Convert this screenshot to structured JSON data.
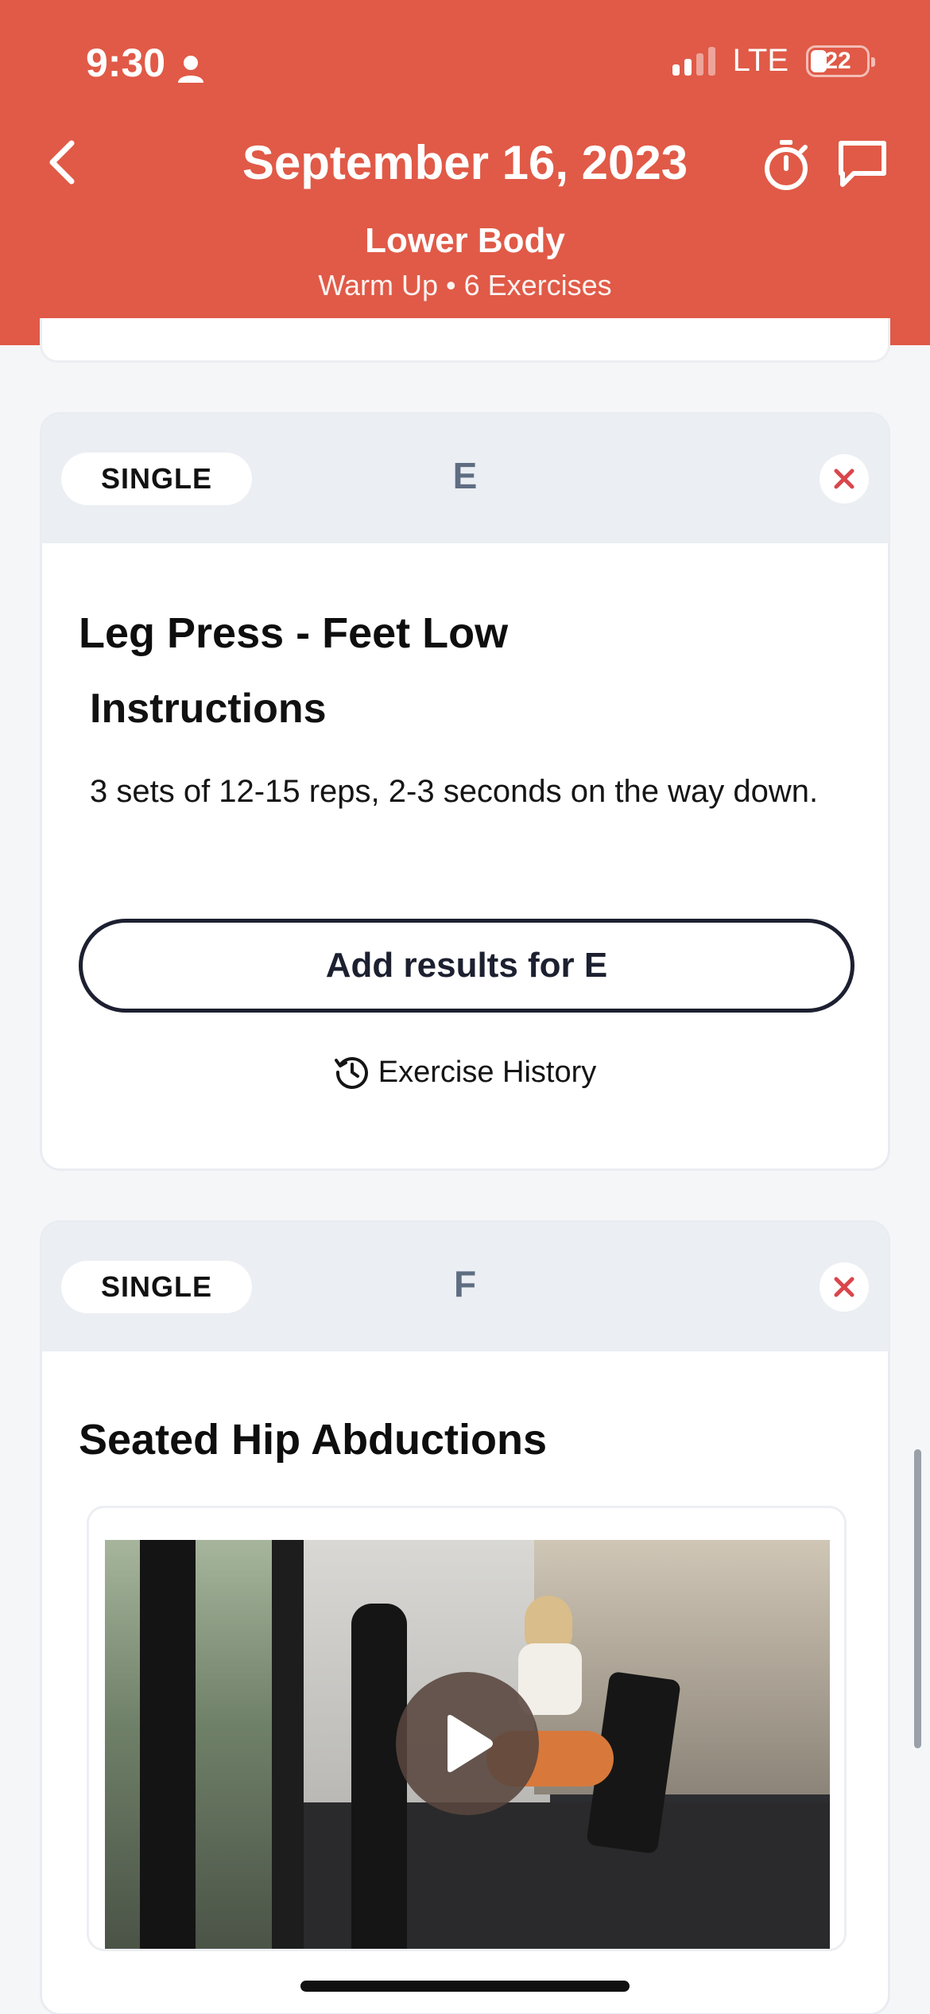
{
  "status_bar": {
    "time": "9:30",
    "network": "LTE",
    "battery": "22",
    "battery_level": 0.22,
    "signal_bars_active": 2
  },
  "header": {
    "title": "September 16, 2023",
    "workout_name": "Lower Body",
    "workout_summary": "Warm Up • 6 Exercises",
    "background_color": "#e05a47"
  },
  "exercises": [
    {
      "type": "SINGLE",
      "group": "E",
      "name": "Leg Press - Feet Low",
      "instructions_heading": "Instructions",
      "instructions": "3 sets of 12-15 reps, 2-3 seconds on the way down.",
      "add_results_label": "Add results for E",
      "history_label": "Exercise History"
    },
    {
      "type": "SINGLE",
      "group": "F",
      "name": "Seated Hip Abductions",
      "media": "video-thumbnail"
    }
  ],
  "icons": {
    "back": "chevron-left-icon",
    "timer": "stopwatch-icon",
    "chat": "chat-bubble-icon",
    "remove": "close-icon",
    "history": "history-clock-icon",
    "play": "play-icon"
  },
  "colors": {
    "accent": "#e05a47",
    "remove": "#d9464b",
    "group_letter": "#5f6d82"
  }
}
